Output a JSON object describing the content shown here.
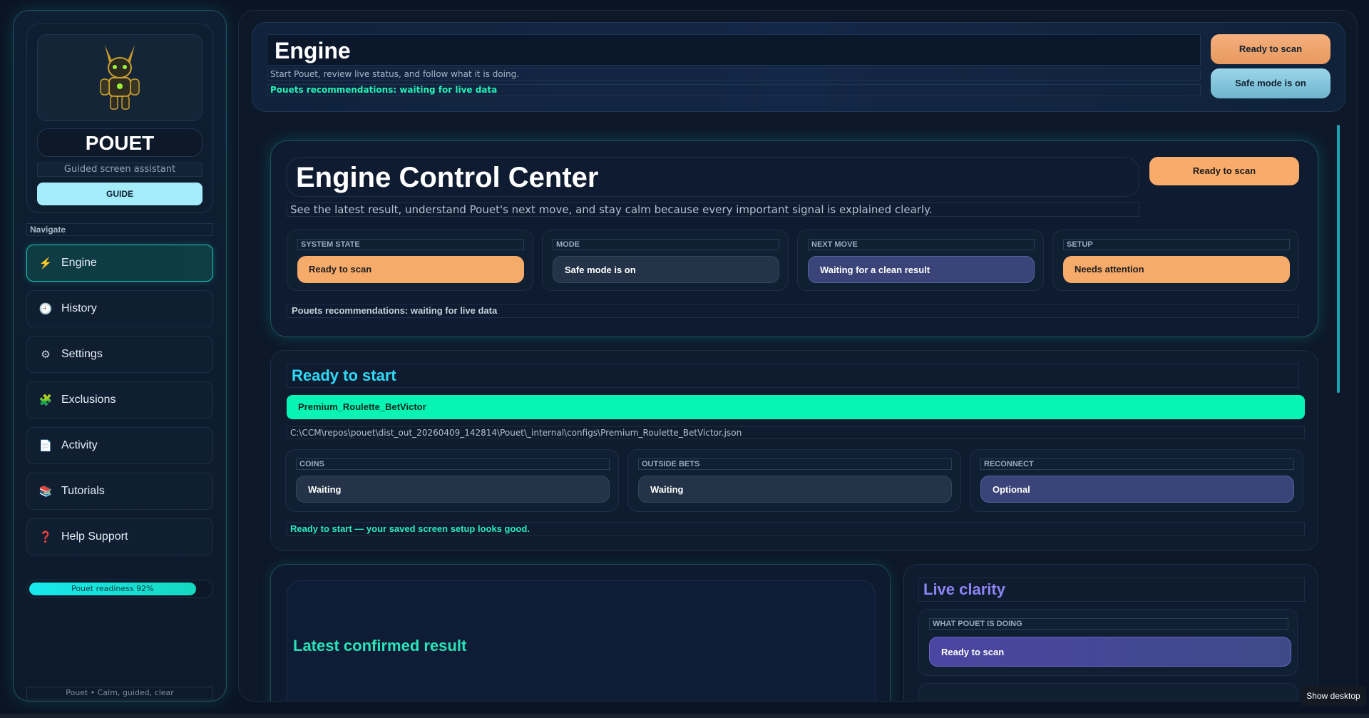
{
  "brand": {
    "name": "POUET",
    "subtitle": "Guided screen assistant",
    "guide_label": "GUIDE"
  },
  "nav": {
    "label": "Navigate",
    "items": [
      {
        "label": "Engine",
        "icon": "lightning-icon",
        "glyph": "⚡",
        "active": true
      },
      {
        "label": "History",
        "icon": "clock-icon",
        "glyph": "🕘",
        "active": false
      },
      {
        "label": "Settings",
        "icon": "gear-icon",
        "glyph": "⚙",
        "active": false
      },
      {
        "label": "Exclusions",
        "icon": "puzzle-icon",
        "glyph": "🧩",
        "active": false
      },
      {
        "label": "Activity",
        "icon": "document-icon",
        "glyph": "📄",
        "active": false
      },
      {
        "label": "Tutorials",
        "icon": "books-icon",
        "glyph": "📚",
        "active": false
      },
      {
        "label": "Help  Support",
        "icon": "question-icon",
        "glyph": "❓",
        "active": false
      }
    ]
  },
  "readiness": {
    "label": "Pouet readiness  92%",
    "value": 0.92
  },
  "sidebar_footer": "Pouet • Calm, guided, clear",
  "topbar": {
    "title": "Engine",
    "subtitle": "Start Pouet, review live status, and follow what it is doing.",
    "recommendation": "Pouets recommendations: waiting for live data",
    "status_button": "Ready to scan",
    "mode_button": "Safe mode is on"
  },
  "control_center": {
    "title": "Engine Control Center",
    "subtitle": "See the latest result, understand Pouet's next move, and stay calm because every important signal is explained clearly.",
    "status_button": "Ready to scan",
    "cards": [
      {
        "label": "SYSTEM STATE",
        "value": "Ready to scan"
      },
      {
        "label": "MODE",
        "value": "Safe mode is on"
      },
      {
        "label": "NEXT MOVE",
        "value": "Waiting for a clean result"
      },
      {
        "label": "SETUP",
        "value": "Needs attention"
      }
    ],
    "recommendation": "Pouets recommendations: waiting for live data"
  },
  "start_panel": {
    "title": "Ready to start",
    "config_name": "Premium_Roulette_BetVictor",
    "config_path": "C:\\CCM\\repos\\pouet\\dist_out_20260409_142814\\Pouet\\_internal\\configs\\Premium_Roulette_BetVictor.json",
    "cards": [
      {
        "label": "COINS",
        "value": "Waiting"
      },
      {
        "label": "OUTSIDE BETS",
        "value": "Waiting"
      },
      {
        "label": "RECONNECT",
        "value": "Optional"
      }
    ],
    "ready_message": "Ready to start — your saved screen setup looks good."
  },
  "result_panel": {
    "title": "Latest confirmed result"
  },
  "clarity_panel": {
    "title": "Live clarity",
    "card_label": "WHAT POUET IS DOING",
    "card_value": "Ready to scan"
  },
  "taskbar": {
    "show_desktop": "Show desktop"
  },
  "colors": {
    "accent_teal": "#1fc4bd",
    "accent_green": "#08f4b5",
    "accent_orange": "#f7ab6a",
    "accent_purple": "#8c85f6",
    "accent_cyan": "#2fd9f5"
  }
}
